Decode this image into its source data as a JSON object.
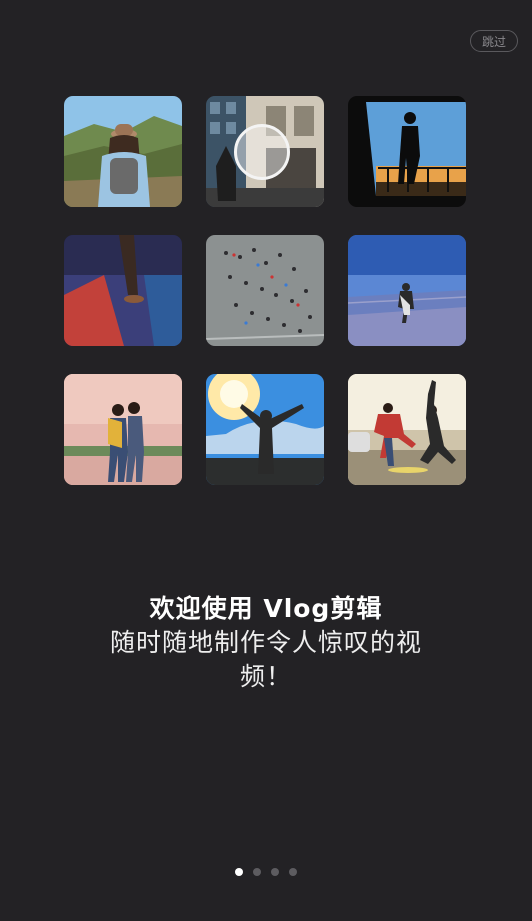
{
  "header": {
    "skip_label": "跳过"
  },
  "gallery": {
    "tiles": [
      {
        "icon": "hiker-backpack-photo"
      },
      {
        "icon": "street-walk-photo"
      },
      {
        "icon": "silhouette-balcony-photo"
      },
      {
        "icon": "night-street-photo"
      },
      {
        "icon": "crowd-aerial-photo"
      },
      {
        "icon": "dusk-running-photo"
      },
      {
        "icon": "couple-river-photo"
      },
      {
        "icon": "sun-arms-raised-photo"
      },
      {
        "icon": "skateboard-friends-photo"
      }
    ]
  },
  "welcome": {
    "title": "欢迎使用 Vlog剪辑",
    "subtitle": "随时随地制作令人惊叹的视频！"
  },
  "pager": {
    "total": 4,
    "active_index": 0
  },
  "colors": {
    "background": "#232225",
    "dot_active": "#ffffff",
    "dot_inactive": "#5d5c60"
  }
}
